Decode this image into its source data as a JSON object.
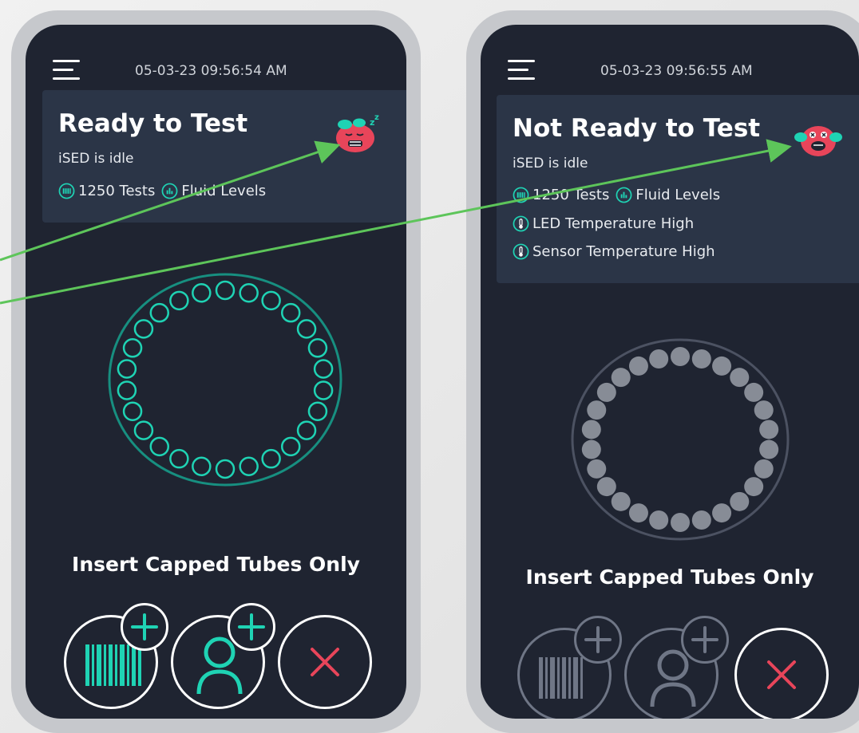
{
  "colors": {
    "accent": "#1fd3b4",
    "carousel_ring": "#178f80",
    "danger": "#e8455a",
    "disabled": "#6f7686",
    "arrow": "#5dc55a",
    "screen_bg": "#1f2431",
    "card_bg": "#2b3547"
  },
  "left_phone": {
    "timestamp": "05-03-23 09:56:54 AM",
    "status": {
      "title": "Ready to Test",
      "subtitle": "iSED is idle",
      "tests_label": "1250 Tests",
      "fluid_label": "Fluid Levels",
      "mascot_icon": "sleeping-mascot-icon"
    },
    "carousel": {
      "slots": 26,
      "state": "empty-outlined"
    },
    "instruction": "Insert Capped Tubes Only",
    "actions": [
      {
        "name": "add-barcode-button",
        "icon": "barcode-icon",
        "badge": "plus-icon",
        "enabled": true
      },
      {
        "name": "add-patient-button",
        "icon": "user-icon",
        "badge": "plus-icon",
        "enabled": true
      },
      {
        "name": "cancel-button",
        "icon": "close-icon",
        "enabled": true
      }
    ]
  },
  "right_phone": {
    "timestamp": "05-03-23 09:56:55 AM",
    "status": {
      "title": "Not Ready to Test",
      "subtitle": "iSED is idle",
      "tests_label": "1250 Tests",
      "fluid_label": "Fluid Levels",
      "warnings": [
        "LED Temperature High",
        "Sensor Temperature High"
      ],
      "mascot_icon": "distressed-mascot-icon"
    },
    "carousel": {
      "slots": 26,
      "state": "filled-grey"
    },
    "instruction": "Insert Capped Tubes Only",
    "actions": [
      {
        "name": "add-barcode-button",
        "icon": "barcode-icon",
        "badge": "plus-icon",
        "enabled": false
      },
      {
        "name": "add-patient-button",
        "icon": "user-icon",
        "badge": "plus-icon",
        "enabled": false
      },
      {
        "name": "cancel-button",
        "icon": "close-icon",
        "enabled": true
      }
    ]
  }
}
